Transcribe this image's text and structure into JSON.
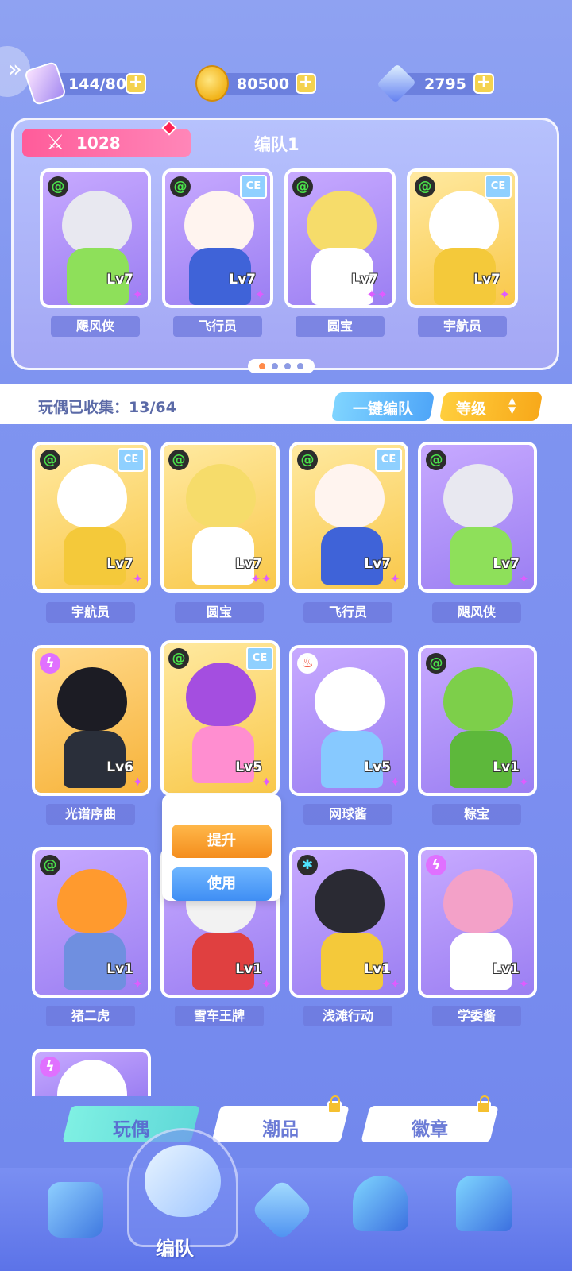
{
  "currencies": {
    "stamina": "144/80",
    "coins": "80500",
    "gems": "2795",
    "plus": "+"
  },
  "team": {
    "power": "1028",
    "title": "编队1",
    "members": [
      {
        "name": "飓风侠",
        "level": "Lv7"
      },
      {
        "name": "飞行员",
        "level": "Lv7"
      },
      {
        "name": "圆宝",
        "level": "Lv7"
      },
      {
        "name": "宇航员",
        "level": "Lv7"
      }
    ]
  },
  "collection": {
    "label": "玩偶已收集：13/64",
    "auto_team": "一键编队",
    "sort": "等级"
  },
  "dolls": [
    {
      "name": "宇航员",
      "level": "Lv7"
    },
    {
      "name": "圆宝",
      "level": "Lv7"
    },
    {
      "name": "飞行员",
      "level": "Lv7"
    },
    {
      "name": "飓风侠",
      "level": "Lv7"
    },
    {
      "name": "光谱序曲",
      "level": "Lv6"
    },
    {
      "name": "",
      "level": "Lv5"
    },
    {
      "name": "网球酱",
      "level": "Lv5"
    },
    {
      "name": "粽宝",
      "level": "Lv1"
    },
    {
      "name": "猪二虎",
      "level": "Lv1"
    },
    {
      "name": "雪车王牌",
      "level": "Lv1"
    },
    {
      "name": "浅滩行动",
      "level": "Lv1"
    },
    {
      "name": "学委酱",
      "level": "Lv1"
    }
  ],
  "context_menu": {
    "upgrade": "提升",
    "use": "使用"
  },
  "tabs": {
    "dolls": "玩偶",
    "trendy": "潮品",
    "badges": "徽章"
  },
  "bottom_nav": {
    "team_label": "编队"
  }
}
